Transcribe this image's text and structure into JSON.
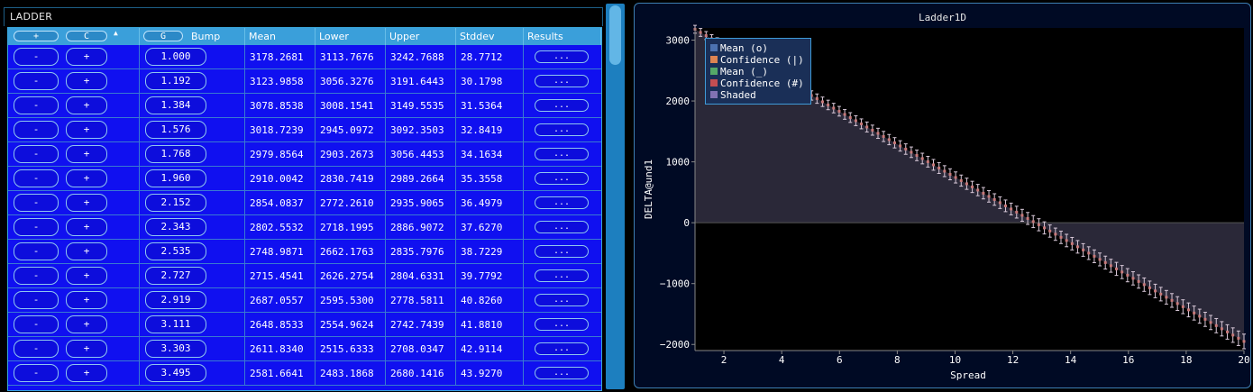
{
  "ladder": {
    "title": "LADDER",
    "header": {
      "add_label": "+",
      "clear_label": "C",
      "sort_indicator": "▲",
      "g_label": "G",
      "bump": "Bump",
      "mean": "Mean",
      "lower": "Lower",
      "upper": "Upper",
      "stddev": "Stddev",
      "results": "Results"
    },
    "minus_label": "-",
    "plus_label": "+",
    "results_label": "...",
    "rows": [
      {
        "bump": "1.000",
        "mean": "3178.2681",
        "lower": "3113.7676",
        "upper": "3242.7688",
        "stddev": "28.7712"
      },
      {
        "bump": "1.192",
        "mean": "3123.9858",
        "lower": "3056.3276",
        "upper": "3191.6443",
        "stddev": "30.1798"
      },
      {
        "bump": "1.384",
        "mean": "3078.8538",
        "lower": "3008.1541",
        "upper": "3149.5535",
        "stddev": "31.5364"
      },
      {
        "bump": "1.576",
        "mean": "3018.7239",
        "lower": "2945.0972",
        "upper": "3092.3503",
        "stddev": "32.8419"
      },
      {
        "bump": "1.768",
        "mean": "2979.8564",
        "lower": "2903.2673",
        "upper": "3056.4453",
        "stddev": "34.1634"
      },
      {
        "bump": "1.960",
        "mean": "2910.0042",
        "lower": "2830.7419",
        "upper": "2989.2664",
        "stddev": "35.3558"
      },
      {
        "bump": "2.152",
        "mean": "2854.0837",
        "lower": "2772.2610",
        "upper": "2935.9065",
        "stddev": "36.4979"
      },
      {
        "bump": "2.343",
        "mean": "2802.5532",
        "lower": "2718.1995",
        "upper": "2886.9072",
        "stddev": "37.6270"
      },
      {
        "bump": "2.535",
        "mean": "2748.9871",
        "lower": "2662.1763",
        "upper": "2835.7976",
        "stddev": "38.7229"
      },
      {
        "bump": "2.727",
        "mean": "2715.4541",
        "lower": "2626.2754",
        "upper": "2804.6331",
        "stddev": "39.7792"
      },
      {
        "bump": "2.919",
        "mean": "2687.0557",
        "lower": "2595.5300",
        "upper": "2778.5811",
        "stddev": "40.8260"
      },
      {
        "bump": "3.111",
        "mean": "2648.8533",
        "lower": "2554.9624",
        "upper": "2742.7439",
        "stddev": "41.8810"
      },
      {
        "bump": "3.303",
        "mean": "2611.8340",
        "lower": "2515.6333",
        "upper": "2708.0347",
        "stddev": "42.9114"
      },
      {
        "bump": "3.495",
        "mean": "2581.6641",
        "lower": "2483.1868",
        "upper": "2680.1416",
        "stddev": "43.9270"
      }
    ]
  },
  "plot": {
    "title": "Ladder1D",
    "xlabel": "Spread",
    "ylabel": "DELTA@und1",
    "x_ticks": [
      "2",
      "4",
      "6",
      "8",
      "10",
      "12",
      "14",
      "16",
      "18",
      "20"
    ],
    "y_ticks": [
      "3000",
      "2000",
      "1000",
      "0",
      "−1000",
      "−2000"
    ],
    "legend": [
      {
        "label": "Mean (o)",
        "color": "#4c72b0"
      },
      {
        "label": "Confidence (|)",
        "color": "#dd8452"
      },
      {
        "label": "Mean (_)",
        "color": "#55a868"
      },
      {
        "label": "Confidence (#)",
        "color": "#c44e52"
      },
      {
        "label": "Shaded",
        "color": "#8172b3"
      }
    ],
    "colors": {
      "background": "#000000",
      "zero_line": "#555555",
      "shade": "#2a2838",
      "marker": "#d8c8d8"
    }
  },
  "chart_data": {
    "type": "line",
    "title": "Ladder1D",
    "xlabel": "Spread",
    "ylabel": "DELTA@und1",
    "xlim": [
      1,
      20
    ],
    "ylim": [
      -2100,
      3200
    ],
    "x_start": 1.0,
    "x_end": 20.0,
    "y_start": 3178.2681,
    "y_end": -1950,
    "n_points": 100,
    "ci_halfwidth_start": 64.5,
    "ci_halfwidth_end": 120,
    "series": [
      {
        "name": "Mean (o)"
      },
      {
        "name": "Confidence (|)"
      },
      {
        "name": "Mean (_)"
      },
      {
        "name": "Confidence (#)"
      },
      {
        "name": "Shaded"
      }
    ]
  }
}
